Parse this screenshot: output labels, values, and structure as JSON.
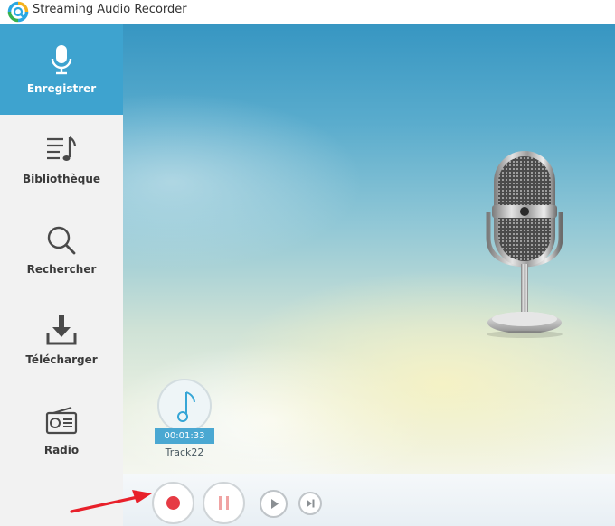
{
  "window": {
    "title": "Streaming Audio Recorder"
  },
  "sidebar": {
    "items": [
      {
        "label": "Enregistrer",
        "icon": "microphone-icon",
        "active": true
      },
      {
        "label": "Bibliothèque",
        "icon": "music-list-icon",
        "active": false
      },
      {
        "label": "Rechercher",
        "icon": "search-icon",
        "active": false
      },
      {
        "label": "Télécharger",
        "icon": "download-icon",
        "active": false
      },
      {
        "label": "Radio",
        "icon": "radio-icon",
        "active": false
      }
    ]
  },
  "track": {
    "time": "00:01:33",
    "name": "Track22"
  },
  "controls": {
    "buttons": [
      "record-button",
      "pause-button",
      "play-button",
      "next-button"
    ]
  },
  "colors": {
    "accent": "#3ea3cf",
    "record": "#e63b45",
    "pause": "#f0a3a3",
    "arrow": "#e8202a"
  }
}
